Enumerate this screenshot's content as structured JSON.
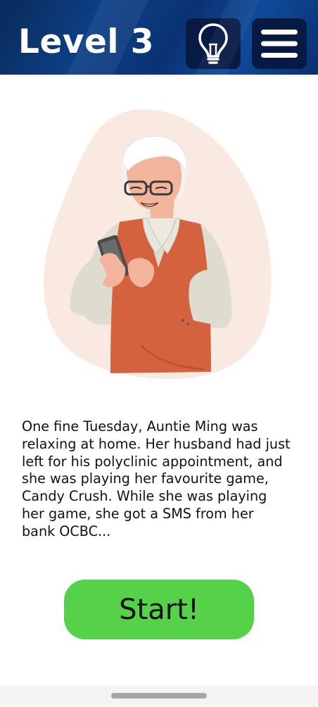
{
  "header": {
    "title": "Level 3",
    "hint_icon": "lightbulb-icon",
    "menu_icon": "hamburger-menu-icon"
  },
  "illustration": {
    "subject": "elderly woman using smartphone"
  },
  "story": {
    "text": "One fine Tuesday, Auntie Ming was\nrelaxing at home. Her husband had just\nleft for his polyclinic appointment, and\nshe was playing her favourite game,\nCandy Crush. While she was playing\nher game, she got a SMS from her\nbank OCBC..."
  },
  "start_button": {
    "label": "Start!"
  },
  "colors": {
    "header_bg": "#0d3f86",
    "icon_bg": "#071a44",
    "start_green": "#55d14a",
    "vest_orange": "#d4623e",
    "blob_pink": "#f9e9e0"
  }
}
